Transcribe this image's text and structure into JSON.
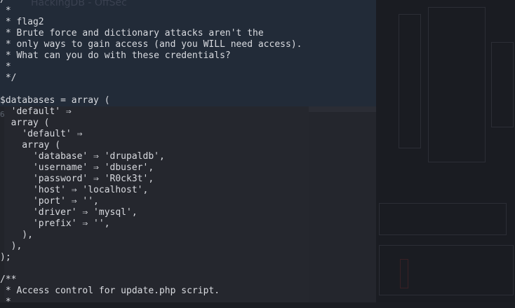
{
  "background": {
    "ghost_tab_text": "HackingDB - OffSec",
    "ghost_line_number": "6"
  },
  "code_lines": [
    "/**",
    " *",
    " * flag2",
    " * Brute force and dictionary attacks aren't the",
    " * only ways to gain access (and you WILL need access).",
    " * What can you do with these credentials?",
    " *",
    " */",
    "",
    "$databases = array (",
    "  'default' ⇒",
    "  array (",
    "    'default' ⇒",
    "    array (",
    "      'database' ⇒ 'drupaldb',",
    "      'username' ⇒ 'dbuser',",
    "      'password' ⇒ 'R0ck3t',",
    "      'host' ⇒ 'localhost',",
    "      'port' ⇒ '',",
    "      'driver' ⇒ 'mysql',",
    "      'prefix' ⇒ '',",
    "    ),",
    "  ),",
    ");",
    "",
    "/**",
    " * Access control for update.php script.",
    " *"
  ]
}
